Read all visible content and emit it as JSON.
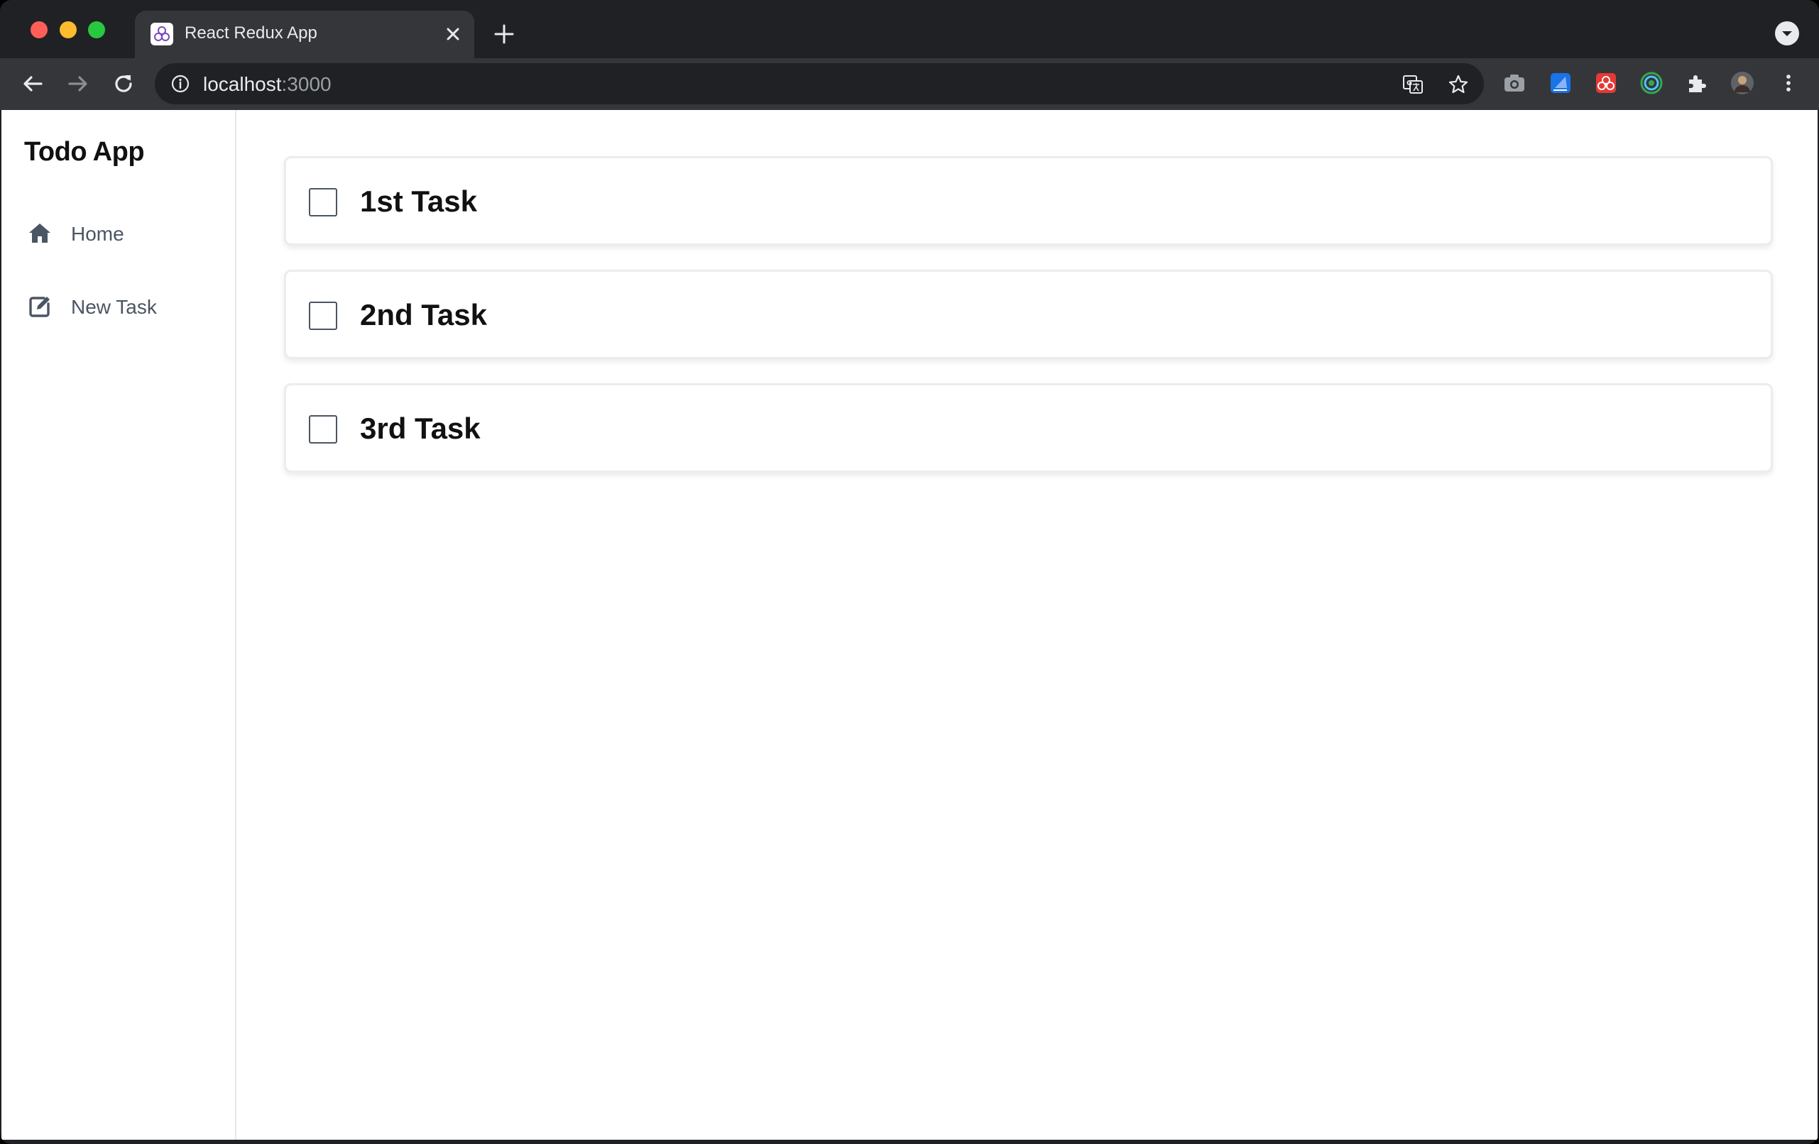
{
  "browser": {
    "tab": {
      "title": "React Redux App",
      "favicon": "redux-icon"
    },
    "address_bar": {
      "host": "localhost",
      "port": ":3000"
    },
    "extensions": [
      "camera-icon",
      "blue-extension-icon",
      "red-extension-icon",
      "green-ring-extension-icon",
      "puzzle-icon",
      "profile-avatar"
    ]
  },
  "sidebar": {
    "app_title": "Todo App",
    "items": [
      {
        "label": "Home",
        "icon": "home-icon"
      },
      {
        "label": "New Task",
        "icon": "edit-icon"
      }
    ]
  },
  "tasks": [
    {
      "title": "1st Task",
      "completed": false
    },
    {
      "title": "2nd Task",
      "completed": false
    },
    {
      "title": "3rd Task",
      "completed": false
    }
  ],
  "colors": {
    "browser_dark": "#202124",
    "toolbar": "#35363a",
    "nav_text": "#4b5563",
    "page_bg": "#ffffff"
  }
}
